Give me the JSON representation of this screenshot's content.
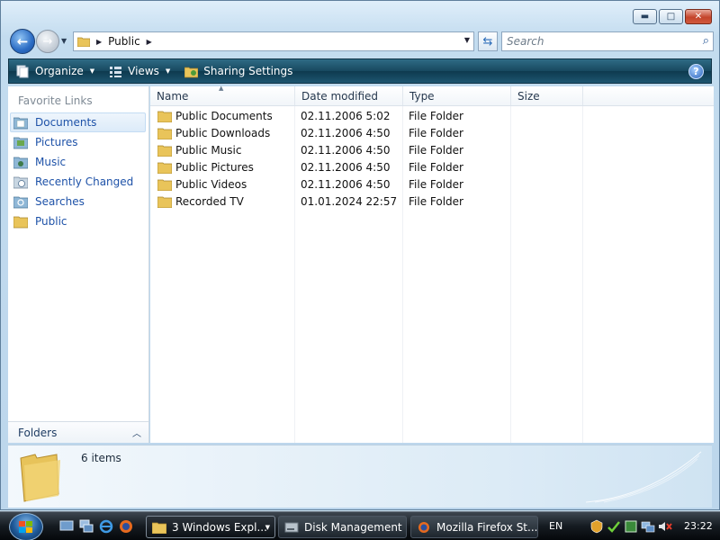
{
  "window": {
    "caption": {
      "minimize_glyph": "▬",
      "maximize_glyph": "□",
      "close_glyph": "✕"
    }
  },
  "address": {
    "crumbs": [
      "Public"
    ],
    "search_placeholder": "Search"
  },
  "toolbar": {
    "organize_label": "Organize",
    "views_label": "Views",
    "sharing_label": "Sharing Settings",
    "help_glyph": "?"
  },
  "nav_pane": {
    "title": "Favorite Links",
    "items": [
      {
        "label": "Documents",
        "icon": "documents-icon",
        "selected": true
      },
      {
        "label": "Pictures",
        "icon": "pictures-icon"
      },
      {
        "label": "Music",
        "icon": "music-icon"
      },
      {
        "label": "Recently Changed",
        "icon": "recent-icon"
      },
      {
        "label": "Searches",
        "icon": "searches-icon"
      },
      {
        "label": "Public",
        "icon": "folder-icon"
      }
    ],
    "folders_label": "Folders"
  },
  "file_list": {
    "columns": [
      "Name",
      "Date modified",
      "Type",
      "Size"
    ],
    "rows": [
      {
        "name": "Public Documents",
        "date": "02.11.2006 5:02",
        "type": "File Folder",
        "size": ""
      },
      {
        "name": "Public Downloads",
        "date": "02.11.2006 4:50",
        "type": "File Folder",
        "size": ""
      },
      {
        "name": "Public Music",
        "date": "02.11.2006 4:50",
        "type": "File Folder",
        "size": ""
      },
      {
        "name": "Public Pictures",
        "date": "02.11.2006 4:50",
        "type": "File Folder",
        "size": ""
      },
      {
        "name": "Public Videos",
        "date": "02.11.2006 4:50",
        "type": "File Folder",
        "size": ""
      },
      {
        "name": "Recorded TV",
        "date": "01.01.2024 22:57",
        "type": "File Folder",
        "size": ""
      }
    ]
  },
  "details": {
    "count": "6 items"
  },
  "taskbar": {
    "buttons": [
      {
        "label": "3 Windows Expl...",
        "active": true
      },
      {
        "label": "Disk Management",
        "active": false
      },
      {
        "label": "Mozilla Firefox St...",
        "active": false
      }
    ],
    "language": "EN",
    "clock": "23:22"
  },
  "colors": {
    "link_blue": "#1e52a8",
    "toolbar_teal": "#17485f",
    "folder_yellow": "#e9c45a"
  }
}
